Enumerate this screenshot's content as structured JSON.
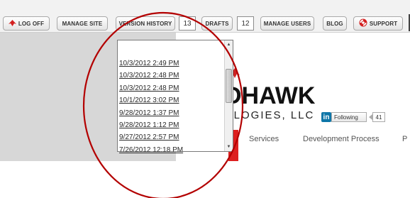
{
  "toolbar": {
    "log_off": "LOG OFF",
    "manage_site": "MANAGE SITE",
    "version_history": "VERSION HISTORY",
    "version_count": "13",
    "drafts": "DRAFTS",
    "drafts_count": "12",
    "manage_users": "MANAGE USERS",
    "blog": "BLOG",
    "support": "SUPPORT"
  },
  "version_dropdown": {
    "items": [
      "10/3/2012 2:49 PM",
      "10/3/2012 2:48 PM",
      "10/3/2012 2:48 PM",
      "10/1/2012 3:02 PM",
      "9/28/2012 1:37 PM",
      "9/28/2012 1:12 PM",
      "9/27/2012 2:57 PM",
      "7/26/2012 12:18 PM"
    ]
  },
  "brand": {
    "logo_main": "DHAWK",
    "logo_sub": "OLOGIES, LLC"
  },
  "linkedin": {
    "icon_text": "in",
    "follow_label": "Following",
    "follower_count": "41"
  },
  "nav": {
    "items": [
      "Services",
      "Development Process",
      "P"
    ]
  },
  "colors": {
    "accent_red": "#dd1f1f",
    "annotation_circle": "#b30000",
    "linkedin_blue": "#0e76a8"
  }
}
